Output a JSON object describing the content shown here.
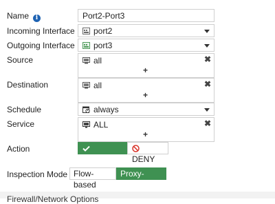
{
  "form": {
    "name_label": "Name",
    "name_value": "Port2-Port3",
    "incoming_label": "Incoming Interface",
    "incoming_value": "port2",
    "outgoing_label": "Outgoing Interface",
    "outgoing_value": "port3",
    "source_label": "Source",
    "source_value": "all",
    "destination_label": "Destination",
    "destination_value": "all",
    "schedule_label": "Schedule",
    "schedule_value": "always",
    "service_label": "Service",
    "service_value": "ALL",
    "action_label": "Action",
    "accept_label": "ACCEPT",
    "deny_label": "DENY",
    "inspection_label": "Inspection Mode",
    "flow_label": "Flow-based",
    "proxy_label": "Proxy-based",
    "add_glyph": "+",
    "remove_glyph": "✖",
    "info_glyph": "i",
    "selected_action": "ACCEPT",
    "selected_mode": "Proxy-based"
  },
  "footer": {
    "section_title": "Firewall/Network Options"
  },
  "colors": {
    "accent_green": "#3f9152",
    "info_blue": "#1f63b3",
    "deny_red": "#d9342b",
    "port_icon_green": "#4f9a5b"
  },
  "icons": {
    "info": "info-icon",
    "incoming": "port-icon",
    "outgoing": "port-green-icon",
    "source": "address-icon",
    "destination": "address-icon",
    "schedule": "calendar-clock-icon",
    "service": "service-icon",
    "accept": "checkmark-icon",
    "deny": "deny-icon",
    "remove": "remove-icon",
    "add": "plus-icon",
    "caret": "chevron-down-icon"
  }
}
